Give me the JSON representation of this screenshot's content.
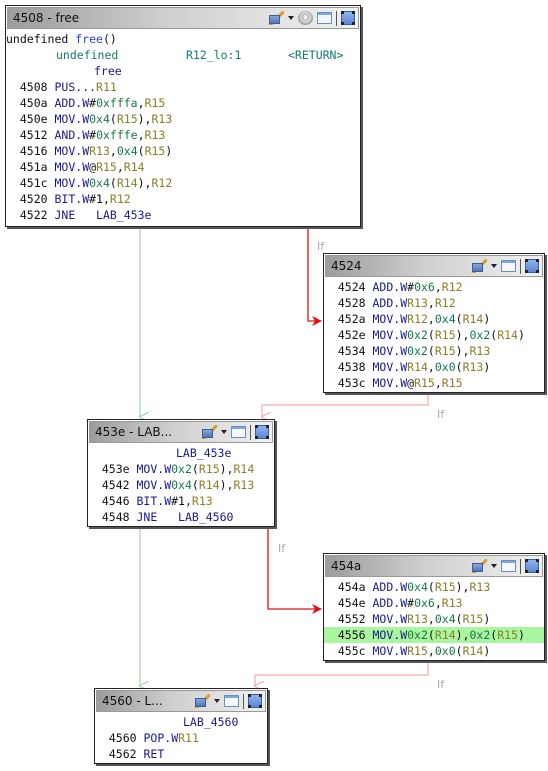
{
  "colors": {
    "fallthrough_edge": "#a9d3a9",
    "taken_edge": "#e01010",
    "taken_edge_faded": "#f4aaaa",
    "highlight_row": "#aaf5a0",
    "mnemonic": "#1a1a8c",
    "register": "#8c7d25",
    "immediate": "#147a4a"
  },
  "toolbar_icons": [
    "paint-brush-icon",
    "dropdown-arrow-icon",
    "window-icon",
    "fullscreen-icon"
  ],
  "blocks": {
    "b4508": {
      "title": "4508 - free",
      "signature": {
        "ret_type": "undefined",
        "fn": "free",
        "parens": "()"
      },
      "params": {
        "type": "undefined",
        "storage": "R12_lo:1",
        "name": "<RETURN>"
      },
      "fn_label": "free",
      "lines": [
        {
          "addr": "4508",
          "mn": "PUS...",
          "ops": [
            [
              "reg",
              "R11"
            ]
          ]
        },
        {
          "addr": "450a",
          "mn": "ADD.W",
          "ops": [
            [
              "blk",
              "#"
            ],
            [
              "num",
              "0xfffa"
            ],
            [
              "blk",
              ","
            ],
            [
              "reg",
              "R15"
            ]
          ]
        },
        {
          "addr": "450e",
          "mn": "MOV.W",
          "ops": [
            [
              "num",
              "0x4"
            ],
            [
              "blk",
              "("
            ],
            [
              "reg",
              "R15"
            ],
            [
              "blk",
              "),"
            ],
            [
              "reg",
              "R13"
            ]
          ]
        },
        {
          "addr": "4512",
          "mn": "AND.W",
          "ops": [
            [
              "blk",
              "#"
            ],
            [
              "num",
              "0xfffe"
            ],
            [
              "blk",
              ","
            ],
            [
              "reg",
              "R13"
            ]
          ]
        },
        {
          "addr": "4516",
          "mn": "MOV.W",
          "ops": [
            [
              "reg",
              "R13"
            ],
            [
              "blk",
              ","
            ],
            [
              "num",
              "0x4"
            ],
            [
              "blk",
              "("
            ],
            [
              "reg",
              "R15"
            ],
            [
              "blk",
              ")"
            ]
          ]
        },
        {
          "addr": "451a",
          "mn": "MOV.W",
          "ops": [
            [
              "blk",
              "@"
            ],
            [
              "reg",
              "R15"
            ],
            [
              "blk",
              ","
            ],
            [
              "reg",
              "R14"
            ]
          ]
        },
        {
          "addr": "451c",
          "mn": "MOV.W",
          "ops": [
            [
              "num",
              "0x4"
            ],
            [
              "blk",
              "("
            ],
            [
              "reg",
              "R14"
            ],
            [
              "blk",
              "),"
            ],
            [
              "reg",
              "R12"
            ]
          ]
        },
        {
          "addr": "4520",
          "mn": "BIT.W",
          "ops": [
            [
              "blk",
              "#1,"
            ],
            [
              "reg",
              "R12"
            ]
          ]
        },
        {
          "addr": "4522",
          "mn": "JNE  ",
          "ops": [
            [
              "lbl",
              " LAB_453e"
            ]
          ]
        }
      ]
    },
    "b4524": {
      "title": "4524",
      "lines": [
        {
          "addr": "4524",
          "mn": "ADD.W",
          "ops": [
            [
              "blk",
              "#"
            ],
            [
              "num",
              "0x6"
            ],
            [
              "blk",
              ","
            ],
            [
              "reg",
              "R12"
            ]
          ]
        },
        {
          "addr": "4528",
          "mn": "ADD.W",
          "ops": [
            [
              "reg",
              "R13"
            ],
            [
              "blk",
              ","
            ],
            [
              "reg",
              "R12"
            ]
          ]
        },
        {
          "addr": "452a",
          "mn": "MOV.W",
          "ops": [
            [
              "reg",
              "R12"
            ],
            [
              "blk",
              ","
            ],
            [
              "num",
              "0x4"
            ],
            [
              "blk",
              "("
            ],
            [
              "reg",
              "R14"
            ],
            [
              "blk",
              ")"
            ]
          ]
        },
        {
          "addr": "452e",
          "mn": "MOV.W",
          "ops": [
            [
              "num",
              "0x2"
            ],
            [
              "blk",
              "("
            ],
            [
              "reg",
              "R15"
            ],
            [
              "blk",
              "),"
            ],
            [
              "num",
              "0x2"
            ],
            [
              "blk",
              "("
            ],
            [
              "reg",
              "R14"
            ],
            [
              "blk",
              ")"
            ]
          ]
        },
        {
          "addr": "4534",
          "mn": "MOV.W",
          "ops": [
            [
              "num",
              "0x2"
            ],
            [
              "blk",
              "("
            ],
            [
              "reg",
              "R15"
            ],
            [
              "blk",
              "),"
            ],
            [
              "reg",
              "R13"
            ]
          ]
        },
        {
          "addr": "4538",
          "mn": "MOV.W",
          "ops": [
            [
              "reg",
              "R14"
            ],
            [
              "blk",
              ","
            ],
            [
              "num",
              "0x0"
            ],
            [
              "blk",
              "("
            ],
            [
              "reg",
              "R13"
            ],
            [
              "blk",
              ")"
            ]
          ]
        },
        {
          "addr": "453c",
          "mn": "MOV.W",
          "ops": [
            [
              "blk",
              "@"
            ],
            [
              "reg",
              "R15"
            ],
            [
              "blk",
              ","
            ],
            [
              "reg",
              "R15"
            ]
          ]
        }
      ]
    },
    "b453e": {
      "title": "453e - LAB...",
      "label": "LAB_453e",
      "lines": [
        {
          "addr": "453e",
          "mn": "MOV.W",
          "ops": [
            [
              "num",
              "0x2"
            ],
            [
              "blk",
              "("
            ],
            [
              "reg",
              "R15"
            ],
            [
              "blk",
              "),"
            ],
            [
              "reg",
              "R14"
            ]
          ]
        },
        {
          "addr": "4542",
          "mn": "MOV.W",
          "ops": [
            [
              "num",
              "0x4"
            ],
            [
              "blk",
              "("
            ],
            [
              "reg",
              "R14"
            ],
            [
              "blk",
              "),"
            ],
            [
              "reg",
              "R13"
            ]
          ]
        },
        {
          "addr": "4546",
          "mn": "BIT.W",
          "ops": [
            [
              "blk",
              "#1,"
            ],
            [
              "reg",
              "R13"
            ]
          ]
        },
        {
          "addr": "4548",
          "mn": "JNE  ",
          "ops": [
            [
              "lbl",
              " LAB_4560"
            ]
          ]
        }
      ]
    },
    "b454a": {
      "title": "454a",
      "lines": [
        {
          "addr": "454a",
          "mn": "ADD.W",
          "ops": [
            [
              "num",
              "0x4"
            ],
            [
              "blk",
              "("
            ],
            [
              "reg",
              "R15"
            ],
            [
              "blk",
              "),"
            ],
            [
              "reg",
              "R13"
            ]
          ]
        },
        {
          "addr": "454e",
          "mn": "ADD.W",
          "ops": [
            [
              "blk",
              "#"
            ],
            [
              "num",
              "0x6"
            ],
            [
              "blk",
              ","
            ],
            [
              "reg",
              "R13"
            ]
          ]
        },
        {
          "addr": "4552",
          "mn": "MOV.W",
          "ops": [
            [
              "reg",
              "R13"
            ],
            [
              "blk",
              ","
            ],
            [
              "num",
              "0x4"
            ],
            [
              "blk",
              "("
            ],
            [
              "reg",
              "R15"
            ],
            [
              "blk",
              ")"
            ]
          ]
        },
        {
          "addr": "4556",
          "mn": "MOV.W",
          "ops": [
            [
              "num",
              "0x2"
            ],
            [
              "blk",
              "("
            ],
            [
              "reg",
              "R14"
            ],
            [
              "blk",
              "),"
            ],
            [
              "num",
              "0x2"
            ],
            [
              "blk",
              "("
            ],
            [
              "reg",
              "R15"
            ],
            [
              "blk",
              ")"
            ]
          ],
          "highlighted": true
        },
        {
          "addr": "455c",
          "mn": "MOV.W",
          "ops": [
            [
              "reg",
              "R15"
            ],
            [
              "blk",
              ","
            ],
            [
              "num",
              "0x0"
            ],
            [
              "blk",
              "("
            ],
            [
              "reg",
              "R14"
            ],
            [
              "blk",
              ")"
            ]
          ]
        }
      ]
    },
    "b4560": {
      "title": "4560 - L...",
      "label": "LAB_4560",
      "lines": [
        {
          "addr": "4560",
          "mn": "POP.W",
          "ops": [
            [
              "reg",
              "R11"
            ]
          ]
        },
        {
          "addr": "4562",
          "mn": "RET",
          "ops": []
        }
      ]
    }
  },
  "edge_labels": {
    "e1": "If",
    "e2": "If",
    "e3": "If",
    "e4": "If"
  }
}
